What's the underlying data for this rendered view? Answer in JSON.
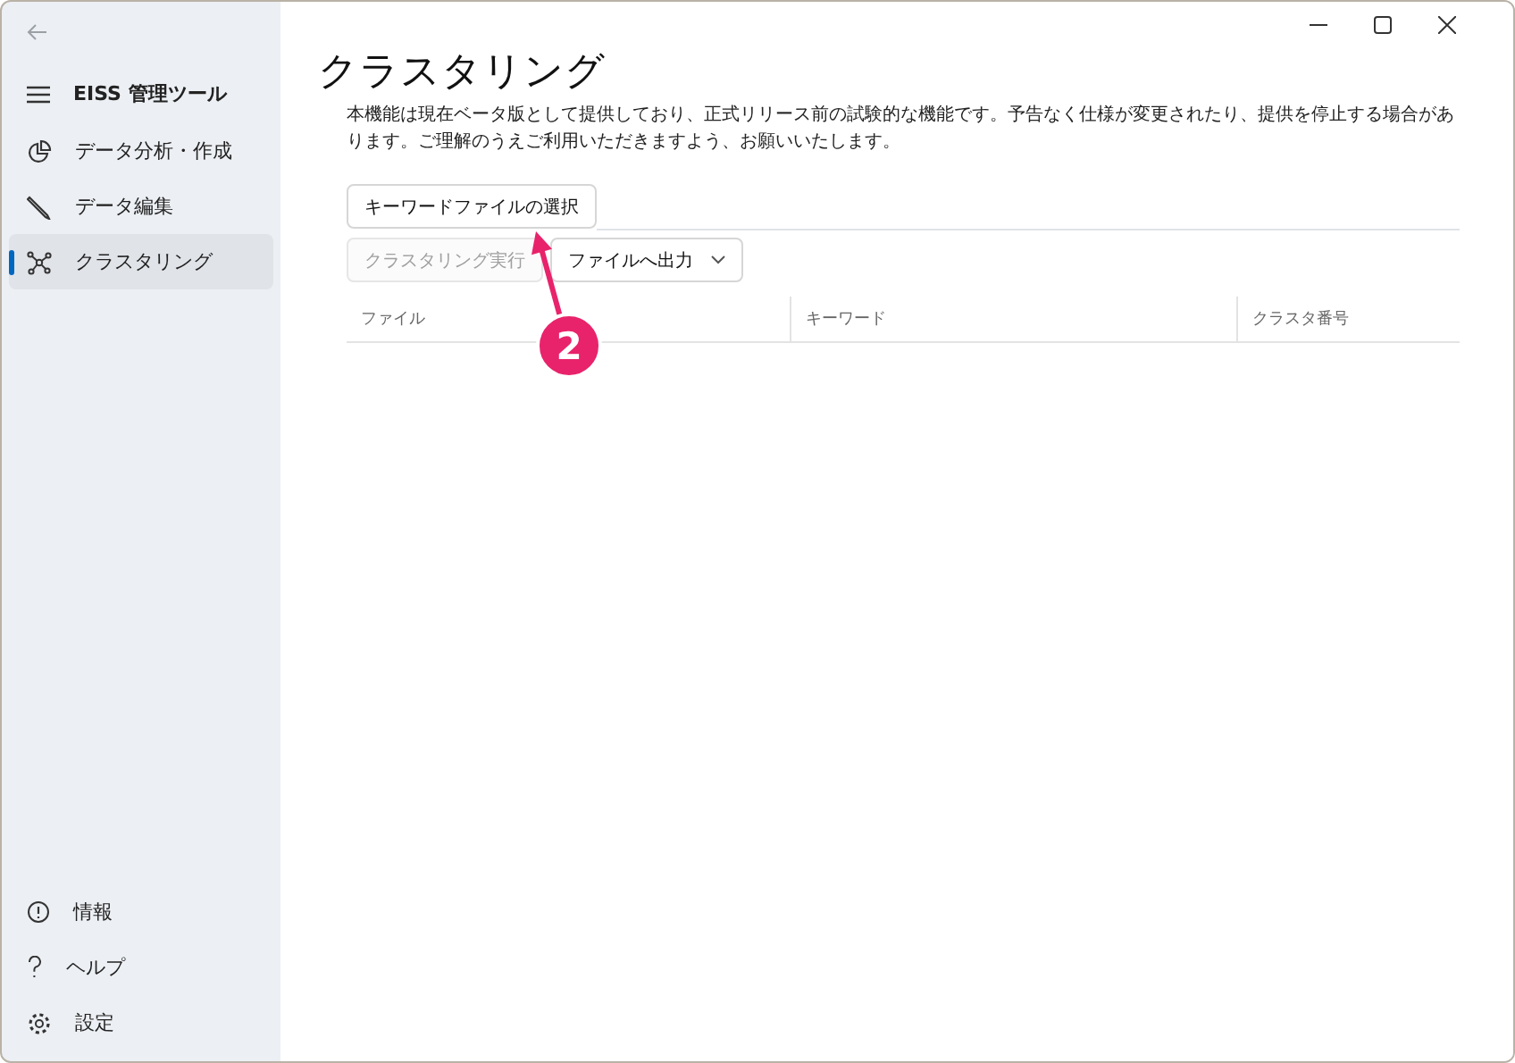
{
  "app_title": "EISS 管理ツール",
  "nav_items": [
    {
      "label": "データ分析・作成",
      "selected": false
    },
    {
      "label": "データ編集",
      "selected": false
    },
    {
      "label": "クラスタリング",
      "selected": true
    }
  ],
  "footer_items": [
    {
      "label": "情報"
    },
    {
      "label": "ヘルプ"
    },
    {
      "label": "設定"
    }
  ],
  "page": {
    "title": "クラスタリング",
    "description": "本機能は現在ベータ版として提供しており、正式リリース前の試験的な機能です。予告なく仕様が変更されたり、提供を停止する場合があります。ご理解のうえご利用いただきますよう、お願いいたします。"
  },
  "select_button": {
    "label": "キーワードファイルの選択",
    "disabled": false
  },
  "run_button": {
    "label": "クラスタリング実行",
    "disabled": true
  },
  "export_button": {
    "label": "ファイルへ出力",
    "disabled": false
  },
  "table": {
    "columns": [
      "ファイル",
      "キーワード",
      "クラスタ番号"
    ]
  },
  "annotation": {
    "label": "2"
  }
}
